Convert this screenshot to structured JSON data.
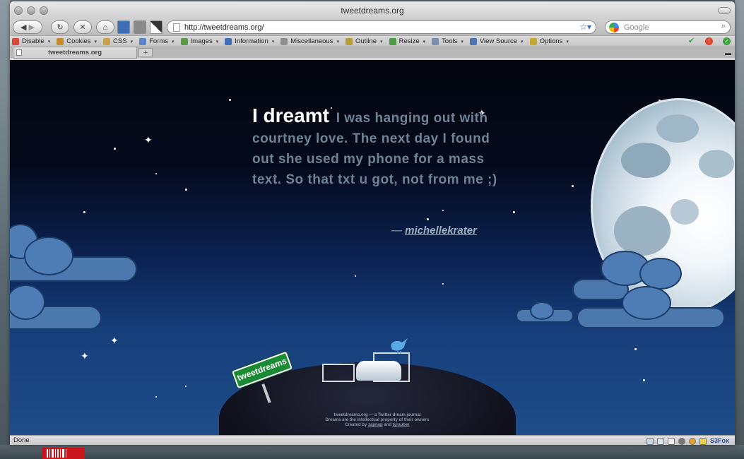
{
  "window": {
    "title": "tweetdreams.org"
  },
  "navigation": {
    "url": "http://tweetdreams.org/",
    "search_placeholder": "Google"
  },
  "devtools": {
    "items": [
      {
        "label": "Disable",
        "icon": "disable-icon",
        "color": "#d9493b"
      },
      {
        "label": "Cookies",
        "icon": "cookie-icon",
        "color": "#c48b2a"
      },
      {
        "label": "CSS",
        "icon": "css-icon",
        "color": "#caa24c"
      },
      {
        "label": "Forms",
        "icon": "forms-icon",
        "color": "#5b86c6"
      },
      {
        "label": "Images",
        "icon": "images-icon",
        "color": "#5c9a4a"
      },
      {
        "label": "Information",
        "icon": "info-icon",
        "color": "#3f6fb8"
      },
      {
        "label": "Miscellaneous",
        "icon": "misc-icon",
        "color": "#8f8f8f"
      },
      {
        "label": "Outline",
        "icon": "outline-icon",
        "color": "#b79c3a"
      },
      {
        "label": "Resize",
        "icon": "resize-icon",
        "color": "#4f9b45"
      },
      {
        "label": "Tools",
        "icon": "tools-icon",
        "color": "#7a8fb0"
      },
      {
        "label": "View Source",
        "icon": "view-source-icon",
        "color": "#4f74b3"
      },
      {
        "label": "Options",
        "icon": "options-icon",
        "color": "#c8a82f"
      }
    ]
  },
  "tab": {
    "title": "tweetdreams.org",
    "new_tab_label": "+"
  },
  "page": {
    "quote_lead": "I dreamt",
    "quote_text": "I was hanging out with courtney love. The next day I found out she used my phone for a mass text. So that txt u got, not from me ;)",
    "author_dash": "—",
    "author": "michellekrater",
    "sign_text": "tweetdreams",
    "footer_line1": "tweetdreams.org — a Twitter dream journal",
    "footer_line2": "Dreams are the intellectual property of their owners",
    "footer_created_by": "Created by",
    "footer_author1": "zapnap",
    "footer_and": "and",
    "footer_author2": "tyrauber"
  },
  "status": {
    "text": "Done",
    "s3fox_label": "S3Fox"
  }
}
